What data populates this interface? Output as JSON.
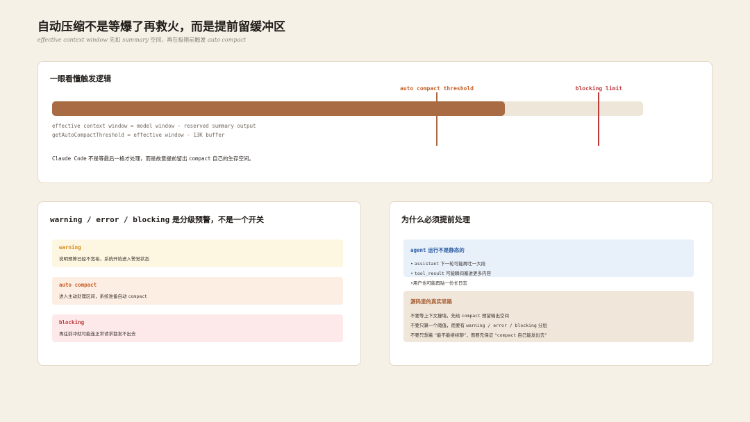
{
  "header": {
    "title": "自动压缩不是等爆了再救火，而是提前留缓冲区",
    "subtitle_1": "effective context window",
    "subtitle_2": " 先扣 ",
    "subtitle_3": "summary",
    "subtitle_4": " 空间，再在极限前触发 ",
    "subtitle_5": "auto compact"
  },
  "top_card": {
    "heading": "一眼看懂触发逻辑",
    "threshold_label": "auto compact threshold",
    "blocking_label": "blocking limit",
    "fill_fraction": 0.766,
    "threshold_fraction": 0.651,
    "blocking_fraction": 0.925,
    "formula_1": "effective context window = model window - reserved summary output",
    "formula_2": "getAutoCompactThreshold = effective window - 13K buffer",
    "note_code": "Claude Code",
    "note_text_1": " 不是等最后一格才处理，而是故意提前留出 ",
    "note_code_2": "compact",
    "note_text_2": " 自己的生存空间。",
    "colors": {
      "fill": "#a86b43",
      "track": "#efe6da",
      "threshold": "#a86b43",
      "blocking": "#c0393b"
    }
  },
  "left_card": {
    "heading_code": "warning / error / blocking",
    "heading_text": " 是分级预警，不是一个开关",
    "levels": [
      {
        "name": "warning",
        "desc": "说明预算已经不宽裕，系统开始进入警觉状态",
        "bg": "#fdf6e0",
        "color": "#d8891a"
      },
      {
        "name": "auto compact",
        "desc_1": "进入主动处理区间，系统准备自动 ",
        "desc_code": "compact",
        "bg": "#fdeee3",
        "color": "#c65f28"
      },
      {
        "name": "blocking",
        "desc": "再往前冲就可能连正常请求都发不出去",
        "bg": "#fde9ea",
        "color": "#c0393b"
      }
    ]
  },
  "right_card": {
    "heading": "为什么必须提前处理",
    "box1": {
      "head_code": "agent",
      "head_text": " 运行不是静态的",
      "line1_code": "assistant",
      "line1_text": " 下一轮可能再吐一大段",
      "line2_code": "tool_result",
      "line2_text": " 可能瞬间塞进更多内容",
      "line3": "用户也可能再贴一份长日志",
      "bullet": "•",
      "bg": "#e8f0fa",
      "color": "#2f5fa3"
    },
    "box2": {
      "head": "源码里的真实思路",
      "line1_a": "不要等上下文撞墙，先给 ",
      "line1_code": "compact",
      "line1_b": " 预留输出空间",
      "line2_a": "不要只算一个阈值，而要有 ",
      "line2_code": "warning / error / blocking",
      "line2_b": " 分层",
      "line3_a": "不要只想着 “能不能继续聊”，而要先保证 “",
      "line3_code": "compact",
      "line3_b": " 自己能发出去”",
      "bg": "#f1e6da",
      "color": "#a65e32"
    }
  }
}
